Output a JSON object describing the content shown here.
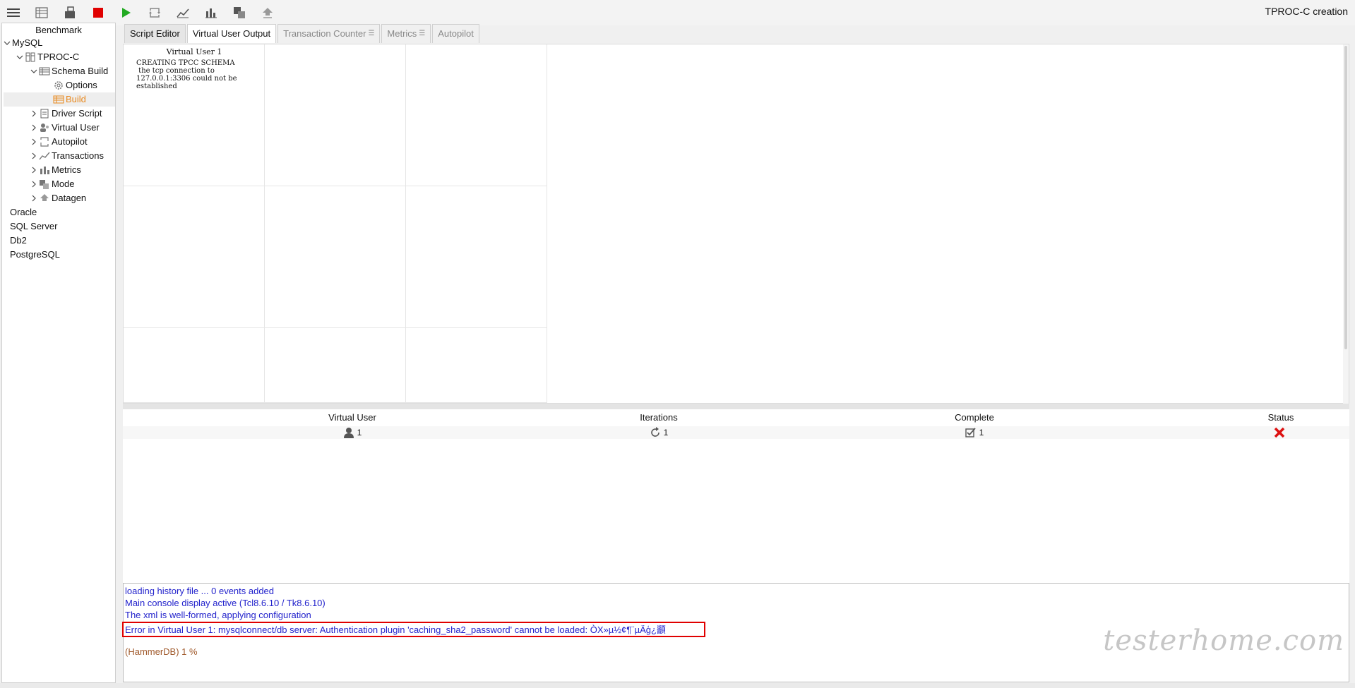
{
  "app": {
    "title": "TPROC-C creation"
  },
  "toolbar": {
    "buttons": [
      {
        "name": "menu-icon"
      },
      {
        "name": "benchmark-icon"
      },
      {
        "name": "schema-build-icon"
      },
      {
        "name": "stop-icon",
        "color": "#e00000"
      },
      {
        "name": "run-icon",
        "color": "#22aa22"
      },
      {
        "name": "autopilot-icon"
      },
      {
        "name": "transactions-icon"
      },
      {
        "name": "metrics-icon"
      },
      {
        "name": "mode-icon"
      },
      {
        "name": "datagen-icon"
      }
    ]
  },
  "tree": {
    "header": "Benchmark",
    "items": {
      "mysql": "MySQL",
      "tproc_c": "TPROC-C",
      "schema_build": "Schema Build",
      "options": "Options",
      "build": "Build",
      "driver_script": "Driver Script",
      "virtual_user": "Virtual User",
      "autopilot": "Autopilot",
      "transactions": "Transactions",
      "metrics": "Metrics",
      "mode": "Mode",
      "datagen": "Datagen",
      "oracle": "Oracle",
      "sql_server": "SQL Server",
      "db2": "Db2",
      "postgresql": "PostgreSQL"
    },
    "selected_color": "#e8891f"
  },
  "tabs": {
    "script_editor": "Script Editor",
    "virtual_user_output": "Virtual User Output",
    "transaction_counter": "Transaction Counter",
    "metrics": "Metrics",
    "autopilot": "Autopilot",
    "menu_glyph": "☰"
  },
  "output": {
    "vu1_title": "Virtual User 1",
    "vu1_log": "CREATING TPCC SCHEMA\n the tcp connection to\n127.0.0.1:3306 could not be\nestablished"
  },
  "status_table": {
    "headers": {
      "virtual_user": "Virtual User",
      "iterations": "Iterations",
      "complete": "Complete",
      "status": "Status"
    },
    "row": {
      "virtual_user": "1",
      "iterations": "1",
      "complete": "1",
      "status_icon": "error-x-icon",
      "status_color": "#dd1111"
    }
  },
  "console": {
    "lines": {
      "l1": "loading history file ... 0 events added",
      "l2": "Main console display active (Tcl8.6.10 / Tk8.6.10)",
      "l3": "The xml is well-formed, applying configuration",
      "l4": "Error in Virtual User 1: mysqlconnect/db server: Authentication plugin 'caching_sha2_password' cannot be loaded: ÒX»µ½¢¶¨µÄģ¿顲"
    },
    "prompt": "(HammerDB) 1 %",
    "text_color": "#2222cc",
    "highlight_color": "#e00000"
  },
  "watermark": "testerhome.com"
}
